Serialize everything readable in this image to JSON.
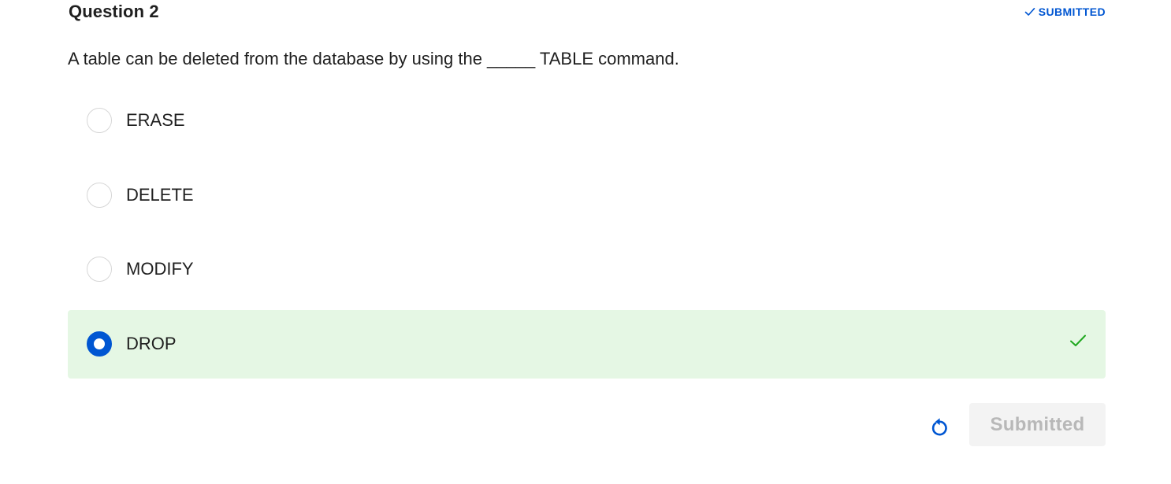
{
  "question": {
    "title": "Question 2",
    "status_label": "SUBMITTED",
    "status_icon": "checkmark-icon",
    "prompt": "A table can be deleted from the database by using the _____ TABLE command."
  },
  "options": [
    {
      "label": "ERASE",
      "selected": false,
      "correct": false
    },
    {
      "label": "DELETE",
      "selected": false,
      "correct": false
    },
    {
      "label": "MODIFY",
      "selected": false,
      "correct": false
    },
    {
      "label": "DROP",
      "selected": true,
      "correct": true
    }
  ],
  "footer": {
    "reset_icon": "reset-icon",
    "submit_label": "Submitted"
  },
  "colors": {
    "accent": "#0056d2",
    "correct_bg": "#e5f7e4",
    "correct_check": "#1fa81f",
    "disabled_bg": "#f3f3f3",
    "disabled_text": "#b8b8b8"
  }
}
